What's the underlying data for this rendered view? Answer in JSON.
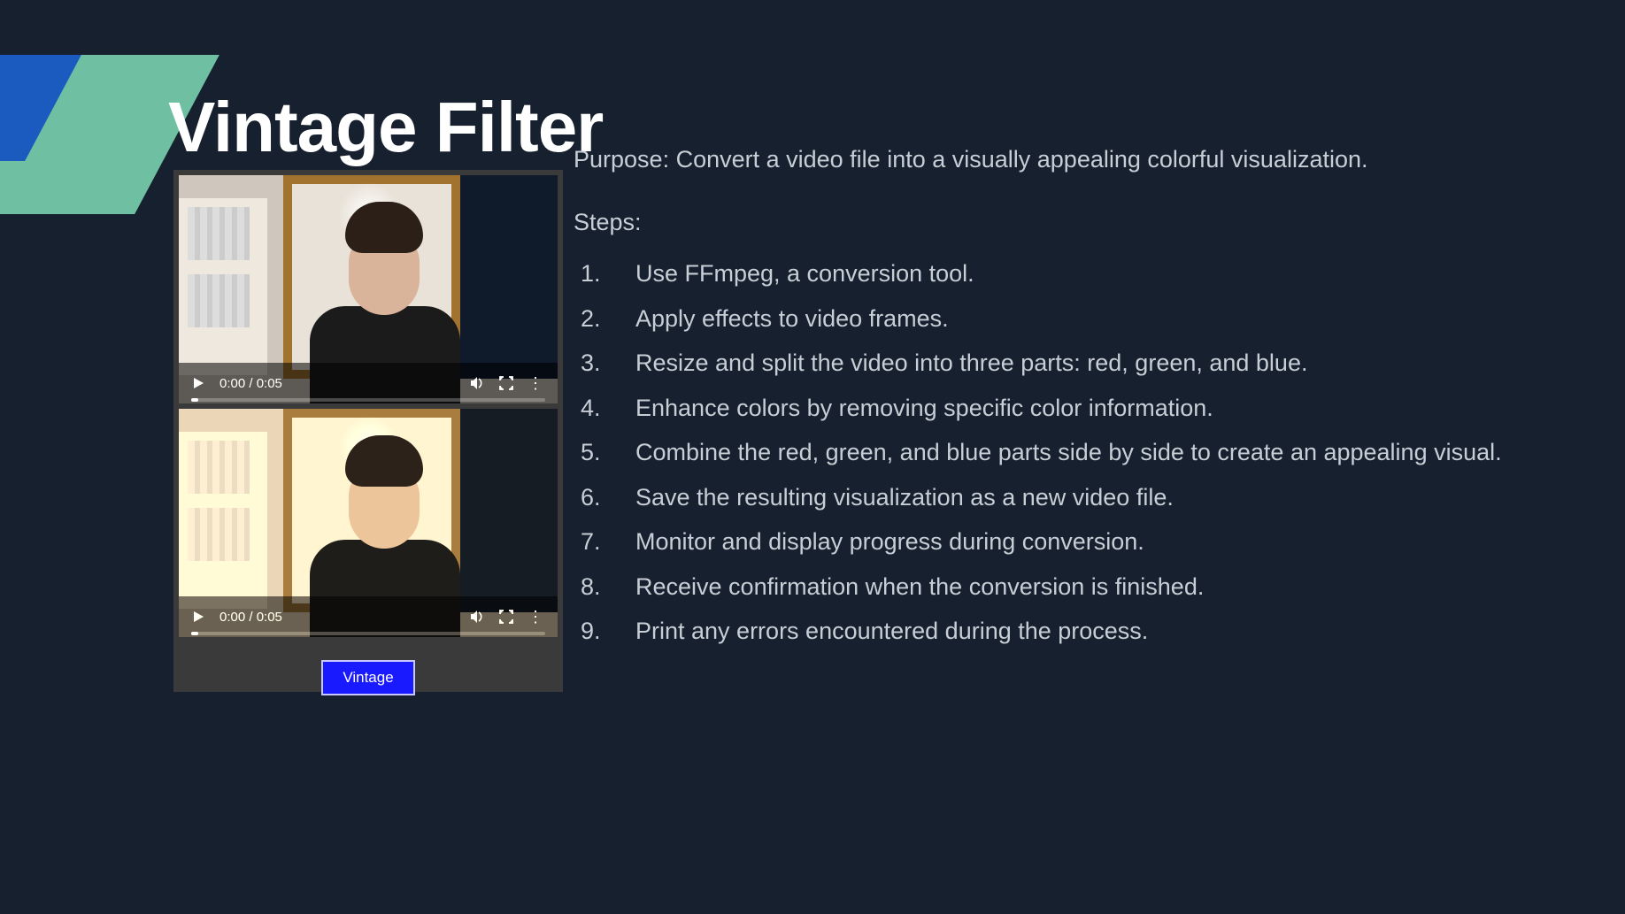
{
  "title": "Vintage Filter",
  "purpose": "Purpose: Convert a video file into a visually appealing colorful visualization.",
  "steps_label": "Steps:",
  "steps": [
    "Use FFmpeg, a conversion tool.",
    "Apply effects to video frames.",
    "Resize and split the video into three parts: red, green, and blue.",
    "Enhance colors by removing specific color information.",
    "Combine the red, green, and blue parts side by side to create an appealing visual.",
    "Save the resulting visualization as a new video file.",
    "Monitor and display progress during conversion.",
    "Receive confirmation when the conversion is finished.",
    "Print any errors encountered during the process."
  ],
  "video": {
    "time_label": "0:00 / 0:05",
    "button_label": "Vintage"
  }
}
